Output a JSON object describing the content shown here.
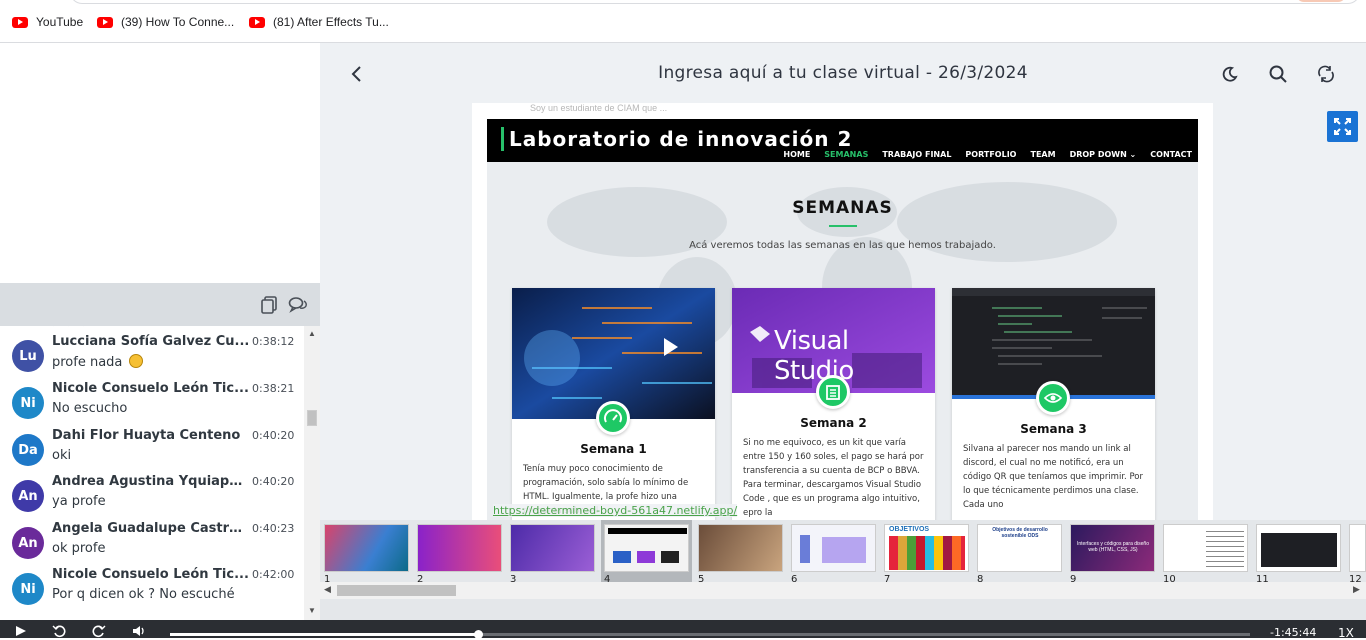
{
  "bookmarks": [
    {
      "label": "YouTube"
    },
    {
      "label": "(39) How To Conne..."
    },
    {
      "label": "(81) After Effects Tu..."
    }
  ],
  "viewer": {
    "title": "Ingresa aquí a tu clase virtual - 26/3/2024",
    "icons": {
      "back": "chevron-left-icon",
      "theme": "moon-icon",
      "search": "search-icon",
      "refresh": "refresh-icon",
      "expand": "expand-icon"
    }
  },
  "chat": {
    "messages": [
      {
        "initials": "Lu",
        "name": "Lucciana Sofía Galvez Cu...",
        "time": "0:38:12",
        "text": "profe nada",
        "emoji": true,
        "color": "#3f51a5"
      },
      {
        "initials": "Ni",
        "name": "Nicole Consuelo León Tic...",
        "time": "0:38:21",
        "text": "No escucho",
        "color": "#1e88c8"
      },
      {
        "initials": "Da",
        "name": "Dahi Flor Huayta Centeno",
        "time": "0:40:20",
        "text": "oki",
        "color": "#1e78c8"
      },
      {
        "initials": "An",
        "name": "Andrea Agustina Yquiapa...",
        "time": "0:40:20",
        "text": "ya profe",
        "color": "#3f3aa8"
      },
      {
        "initials": "An",
        "name": "Angela Guadalupe Castro...",
        "time": "0:40:23",
        "text": "ok profe",
        "color": "#6a2a9a"
      },
      {
        "initials": "Ni",
        "name": "Nicole Consuelo León Tic...",
        "time": "0:42:00",
        "text": "Por q dicen ok ? No escuché",
        "color": "#1e88c8"
      }
    ]
  },
  "slide": {
    "faint_left": "Soy un estudiante de CIAM que ...",
    "site_title": "Laboratorio de innovación 2",
    "nav": [
      "HOME",
      "SEMANAS",
      "TRABAJO FINAL",
      "PORTFOLIO",
      "TEAM",
      "DROP DOWN ⌄",
      "CONTACT"
    ],
    "heading": "SEMANAS",
    "subheading": "Acá veremos todas las semanas en las que hemos trabajado.",
    "cards": [
      {
        "title": "Semana 1",
        "text": "Tenía muy poco conocimiento de programación, solo sabía lo mínimo de HTML. Igualmente, la profe hizo una pregunta sobre el"
      },
      {
        "title": "Semana 2",
        "text": "Si no me equivoco, es un kit que varía entre 150 y 160 soles, el pago se hará por transferencia a su cuenta de BCP o BBVA. Para terminar, descargamos Visual Studio Code , que es un programa algo intuitivo, epro la"
      },
      {
        "title": "Semana 3",
        "text": "Silvana al parecer nos mando un link al discord, el cual no me notificó, era un código QR que teníamos que imprimir. Por lo que técnicamente perdimos una clase. Cada uno"
      }
    ],
    "vs_logo": "Visual Studio",
    "url": "https://determined-boyd-561a47.netlify.app/"
  },
  "thumbnails": [
    {
      "num": "1"
    },
    {
      "num": "2"
    },
    {
      "num": "3"
    },
    {
      "num": "4"
    },
    {
      "num": "5"
    },
    {
      "num": "6"
    },
    {
      "num": "7"
    },
    {
      "num": "8"
    },
    {
      "num": "9"
    },
    {
      "num": "10"
    },
    {
      "num": "11"
    },
    {
      "num": "12"
    }
  ],
  "thumb_text": {
    "t7": "OBJETIVOS",
    "t8": "Objetivos de desarrollo sostenible ODS",
    "t9": "Interfaces y códigos para diseño web (HTML, CSS, JS)"
  },
  "selected_thumbnail": 4,
  "player": {
    "time": "-1:45:44",
    "speed": "1X",
    "progress": 0.285
  }
}
